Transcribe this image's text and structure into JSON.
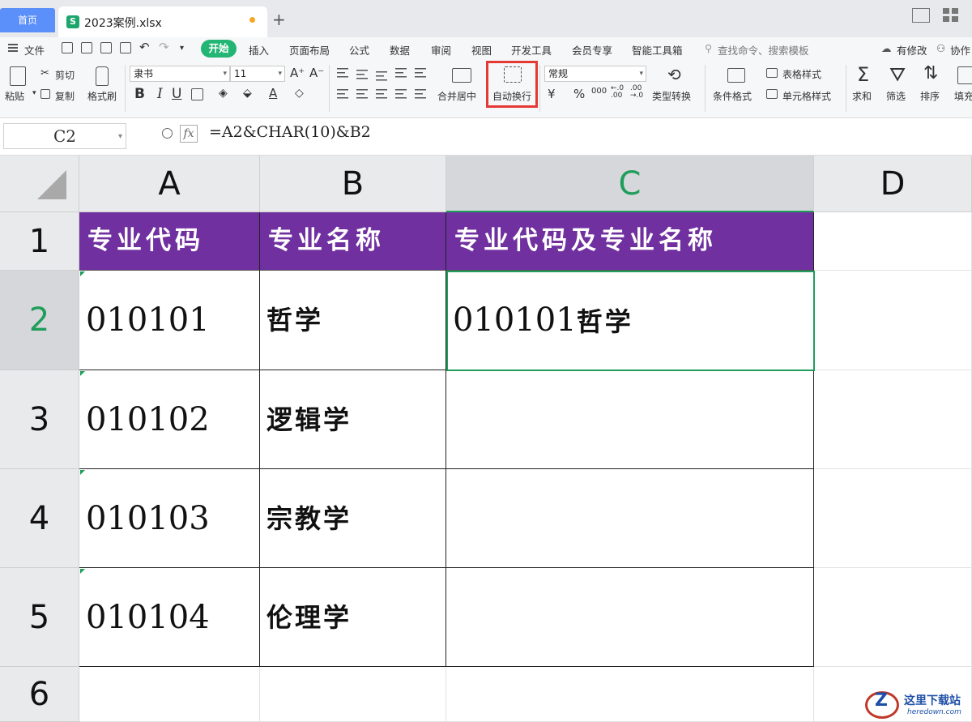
{
  "tabs": {
    "home": "首页",
    "file": "2023案例.xlsx",
    "add": "+"
  },
  "menu": {
    "file": "文件",
    "start": "开始",
    "items": [
      "插入",
      "页面布局",
      "公式",
      "数据",
      "审阅",
      "视图",
      "开发工具",
      "会员专享",
      "智能工具箱"
    ],
    "search": "查找命令、搜索模板",
    "modified": "有修改",
    "collab": "协作"
  },
  "ribbon": {
    "paste": "粘贴",
    "cut": "剪切",
    "copy": "复制",
    "format_painter": "格式刷",
    "font_name": "隶书",
    "font_size": "11",
    "bold": "B",
    "italic": "I",
    "underline": "U",
    "grow": "A⁺",
    "shrink": "A⁻",
    "merge_center": "合并居中",
    "wrap_text": "自动换行",
    "number_format": "常规",
    "currency": "¥",
    "percent": "%",
    "thousands": "000",
    "inc_decimal": "←.0 .00",
    "dec_decimal": ".00 →.0",
    "type_convert": "类型转换",
    "conditional_format": "条件格式",
    "table_style": "表格样式",
    "cell_style": "单元格样式",
    "sum": "求和",
    "filter": "筛选",
    "sort": "排序",
    "fill": "填充"
  },
  "formula_bar": {
    "cell_ref": "C2",
    "fx": "fx",
    "formula": "=A2&CHAR(10)&B2"
  },
  "grid": {
    "columns": [
      "A",
      "B",
      "C",
      "D"
    ],
    "rows": [
      "1",
      "2",
      "3",
      "4",
      "5",
      "6"
    ],
    "header": [
      "专业代码",
      "专业名称",
      "专业代码及专业名称"
    ],
    "data": [
      {
        "code": "010101",
        "name": "哲学",
        "result_code": "010101",
        "result_name": "哲学"
      },
      {
        "code": "010102",
        "name": "逻辑学"
      },
      {
        "code": "010103",
        "name": "宗教学"
      },
      {
        "code": "010104",
        "name": "伦理学"
      }
    ],
    "active_cell": "C2"
  },
  "watermark": {
    "logo": "Z",
    "title": "这里下载站",
    "url": "heredown.com"
  },
  "colors": {
    "header_fill": "#7030a0",
    "selection": "#1f9d5a",
    "start_tab": "#22b573",
    "highlight": "#e53935"
  }
}
